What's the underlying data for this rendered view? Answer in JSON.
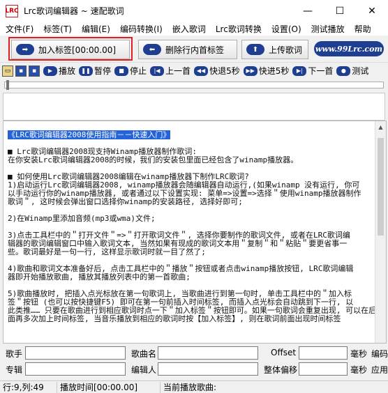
{
  "window": {
    "icon_text": "LRC",
    "title": "Lrc歌词编辑器  ~ 速配歌词",
    "minimize": "—",
    "maximize": "☐",
    "close": "✕"
  },
  "menu": [
    "文件(F)",
    "标签(T)",
    "编辑(E)",
    "编码转换(I)",
    "嵌入歌词",
    "Lrc歌词转换",
    "设置(O)",
    "测试播放",
    "帮助"
  ],
  "toolbar": {
    "add_tag": "加入标签[00:00.00]",
    "delete_tag": "删除行内首标签",
    "upload": "上传歌词",
    "logo": "www.99Lrc.com"
  },
  "player": {
    "play": "播放",
    "pause": "暂停",
    "stop": "停止",
    "prev": "上一首",
    "rewind": "快退5秒",
    "forward": "快进5秒",
    "next": "下一首",
    "test": "测试"
  },
  "editor_lines": [
    "《LRC歌词编辑器2008使用指南－－快速入门》",
    "",
    "■ Lrc歌词编辑器2008现支持Winamp播放器制作歌词:",
    "在你安装Lrc歌词编辑器2008的时候，我们的安装包里面已经包含了winamp播放器。",
    "",
    "■ 如何使用Lrc歌词编辑器2008编辑在winamp播放器下制作LRC歌词?",
    "1)启动运行Lrc歌词编辑器2008, winamp播放器会随编辑器自动运行,(如果winamp 没有运行, 你可",
    "以手动运行你的winamp播放器, 或者通过以下设置实现: 菜单=>设置=>选择＂使用winamp播放器制作",
    "歌词＂, 这时候会弹出窗口选择你winamp的安装路径, 选择好即可;",
    "",
    "2)在Winamp里添加音频(mp3或wma)文件;",
    "",
    "3)点击工具栏中的＂打开文件＂=>＂打开歌词文件＂, 选择你要制作的歌词文件, 或者在LRC歌词编",
    "辑器的歌词编辑窗口中输入歌词文本, 当然如果有现成的歌词文本用＂复制＂和＂粘贴＂要更省事一",
    "些。歌词最好是一句一行, 这样显示歌词时就一目了然了;",
    "",
    "4)歌曲和歌词文本准备好后, 点击工具栏中的＂播放＂按钮或者点击winamp播放按钮, LRC歌词编辑",
    "器即开始播放歌曲, 播放其播放列表中的第一首歌曲;",
    "",
    "5)歌曲播放时, 把插入点光标放在第一句歌词上, 当歌曲进行到第一句时, 单击工具栏中的＂加入标",
    "签＂按钮 (也可以按快捷键F5) 即可在第一句前插入时间标签, 而插入点光标会自动跳到下一行, 以",
    "此类推…… 只要在歌曲进行到相应歌词时点一下＂加入标签＂按钮即可。如果一句歌词会重复出现, 可以在后",
    "面再多次加上时间标签, 当音乐播放到相应的歌词时按【加入标签】, 则在歌词前面出现时间标签"
  ],
  "fields": {
    "singer": "歌手",
    "song": "歌曲名",
    "offset": "Offset",
    "ms1": "毫秒",
    "encoding": "编码",
    "album": "专辑",
    "editor": "编辑人",
    "global_offset": "整体偏移",
    "ms2": "毫秒",
    "apply": "应用"
  },
  "status": {
    "position": "行:9,列:49",
    "play_time": "播放时间[00:00.00]",
    "current_song": "当前播放歌曲:"
  }
}
